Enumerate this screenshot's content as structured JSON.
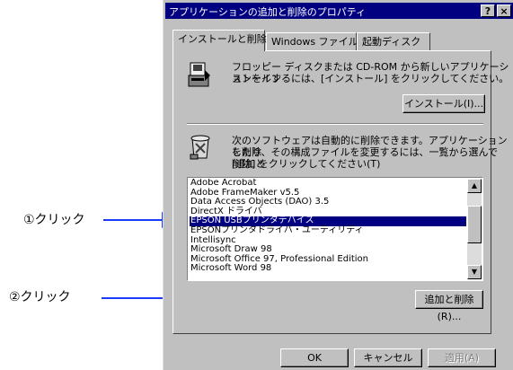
{
  "annotations": {
    "click1": "①クリック",
    "click2": "②クリック"
  },
  "dialog": {
    "title": "アプリケーションの追加と削除のプロパティ",
    "help_btn": "?",
    "close_btn": "×",
    "tabs": [
      "インストールと削除",
      "Windows ファイル",
      "起動ディスク"
    ],
    "install_text_1": "フロッピー ディスクまたは CD-ROM から新しいアプリケーションをイン",
    "install_text_2": "ストールするには、[インストール] をクリックしてください。",
    "install_button": "インストール(I)...",
    "remove_text_1": "次のソフトウェアは自動的に削除できます。アプリケーションを削除",
    "remove_text_2": "したり、その構成ファイルを変更するには、一覧から選んで [追加と",
    "remove_text_3": "削除] をクリックしてください(T)",
    "programs": [
      "Adobe Acrobat",
      "Adobe FrameMaker v5.5",
      "Data Access Objects (DAO) 3.5",
      "DirectX ドライバ",
      "EPSON USBプリンタデバイス",
      "EPSONプリンタドライバ・ユーティリティ",
      "Intellisync",
      "Microsoft Draw 98",
      "Microsoft Office 97, Professional Edition",
      "Microsoft Word 98"
    ],
    "selected_index": 4,
    "add_remove_button": "追加と削除(R)...",
    "ok_button": "OK",
    "cancel_button": "キャンセル",
    "apply_button": "適用(A)",
    "icons": {
      "install": "install-disk-icon",
      "remove": "recycle-bin-icon",
      "scroll_up": "scroll-up-icon",
      "scroll_down": "scroll-down-icon"
    }
  }
}
